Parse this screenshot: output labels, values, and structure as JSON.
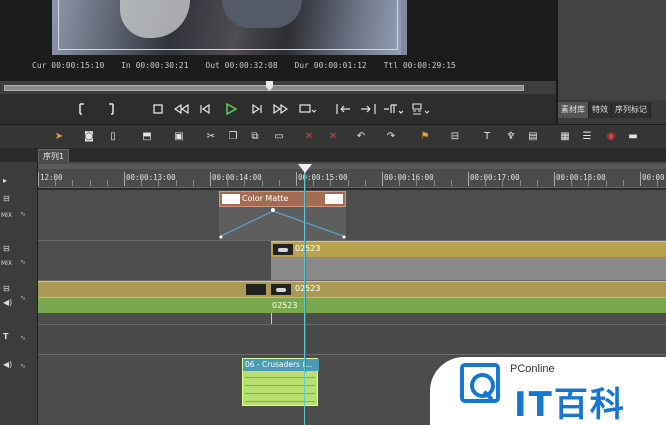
{
  "player": {
    "timecodes": [
      {
        "label": "Cur",
        "value": "00:00:15:10"
      },
      {
        "label": "In",
        "value": "00:00:30:21"
      },
      {
        "label": "Out",
        "value": "00:00:32:08"
      },
      {
        "label": "Dur",
        "value": "00:00:01:12"
      },
      {
        "label": "Ttl",
        "value": "00:00:29:15"
      }
    ]
  },
  "panel": {
    "tabs": [
      "素材库",
      "特效",
      "序列标记"
    ]
  },
  "sequence": {
    "tab_label": "序列1"
  },
  "ruler": {
    "labels": [
      "12:00",
      "00:00:13:00",
      "00:00:14:00",
      "00:00:15:00",
      "00:00:16:00",
      "00:00:17:00",
      "00:00:18:00",
      "00:00:19:00"
    ]
  },
  "tracks": {
    "mix_label": "MIX",
    "title_label": "T",
    "color_matte_label": "Color Matte",
    "clip_v1_label": "02523",
    "clip_va_label": "02523",
    "clip_a1_label": "02523",
    "audio_clip_label": "06 - Crusaders (..."
  },
  "watermark": {
    "brand": "PConline",
    "big": "IT百科"
  },
  "colors": {
    "playhead": "#5fc8d8",
    "video_clip": "#b9a24e",
    "audio_clip": "#79a84e",
    "color_matte": "#a36c52",
    "brand_blue": "#1677d2"
  }
}
